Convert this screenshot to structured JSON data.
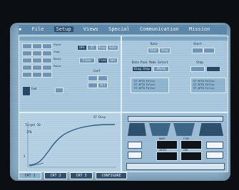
{
  "menubar": {
    "items": [
      "File",
      "Setup",
      "Views",
      "Special",
      "Communication",
      "Mission"
    ],
    "active_index": 1
  },
  "left_panel": {
    "fields": [
      "Start",
      "Stop",
      "Reset",
      "Pause"
    ],
    "buttons": [
      "DFE",
      "ST",
      "Disp",
      "Auto",
      "Clear",
      "Find",
      "Set",
      "All"
    ],
    "section_labels": [
      "Fwd",
      "Conf"
    ]
  },
  "right_panel": {
    "top_labels": [
      "Stat",
      "Stop"
    ],
    "labels": [
      "Rate",
      "Start",
      "Stop"
    ],
    "mid_label": "Data Pack Mode Select",
    "mid_buttons": [
      "Diag Stop",
      "AR/S1"
    ],
    "list_left": [
      "ST AFTO Fullsc",
      "ST AFTO Fullsc",
      "ST AFTO Fullsc"
    ],
    "list_right": [
      "ST AFTO Fullsc",
      "ST AFTO Fullsc",
      "ST AFTO Fullsc"
    ]
  },
  "graph": {
    "title": "ST Disp",
    "target_label": "Target",
    "target_value": "20",
    "y_label": "1TN",
    "marker_label": "S"
  },
  "controls": {
    "box_labels": [
      "MODE",
      "FIRE",
      "INTEG",
      "CMD"
    ]
  },
  "tabs": [
    "CRT 1",
    "CRT 2",
    "CRT 3",
    "CONFIGURE"
  ],
  "active_tab": 0,
  "colors": {
    "screen": "#8fb6d2",
    "menubar": "#5c87aa",
    "tab_active": "#8db3d0",
    "tab": "#2d4f6d",
    "graph_curve": "#2f5a82"
  }
}
